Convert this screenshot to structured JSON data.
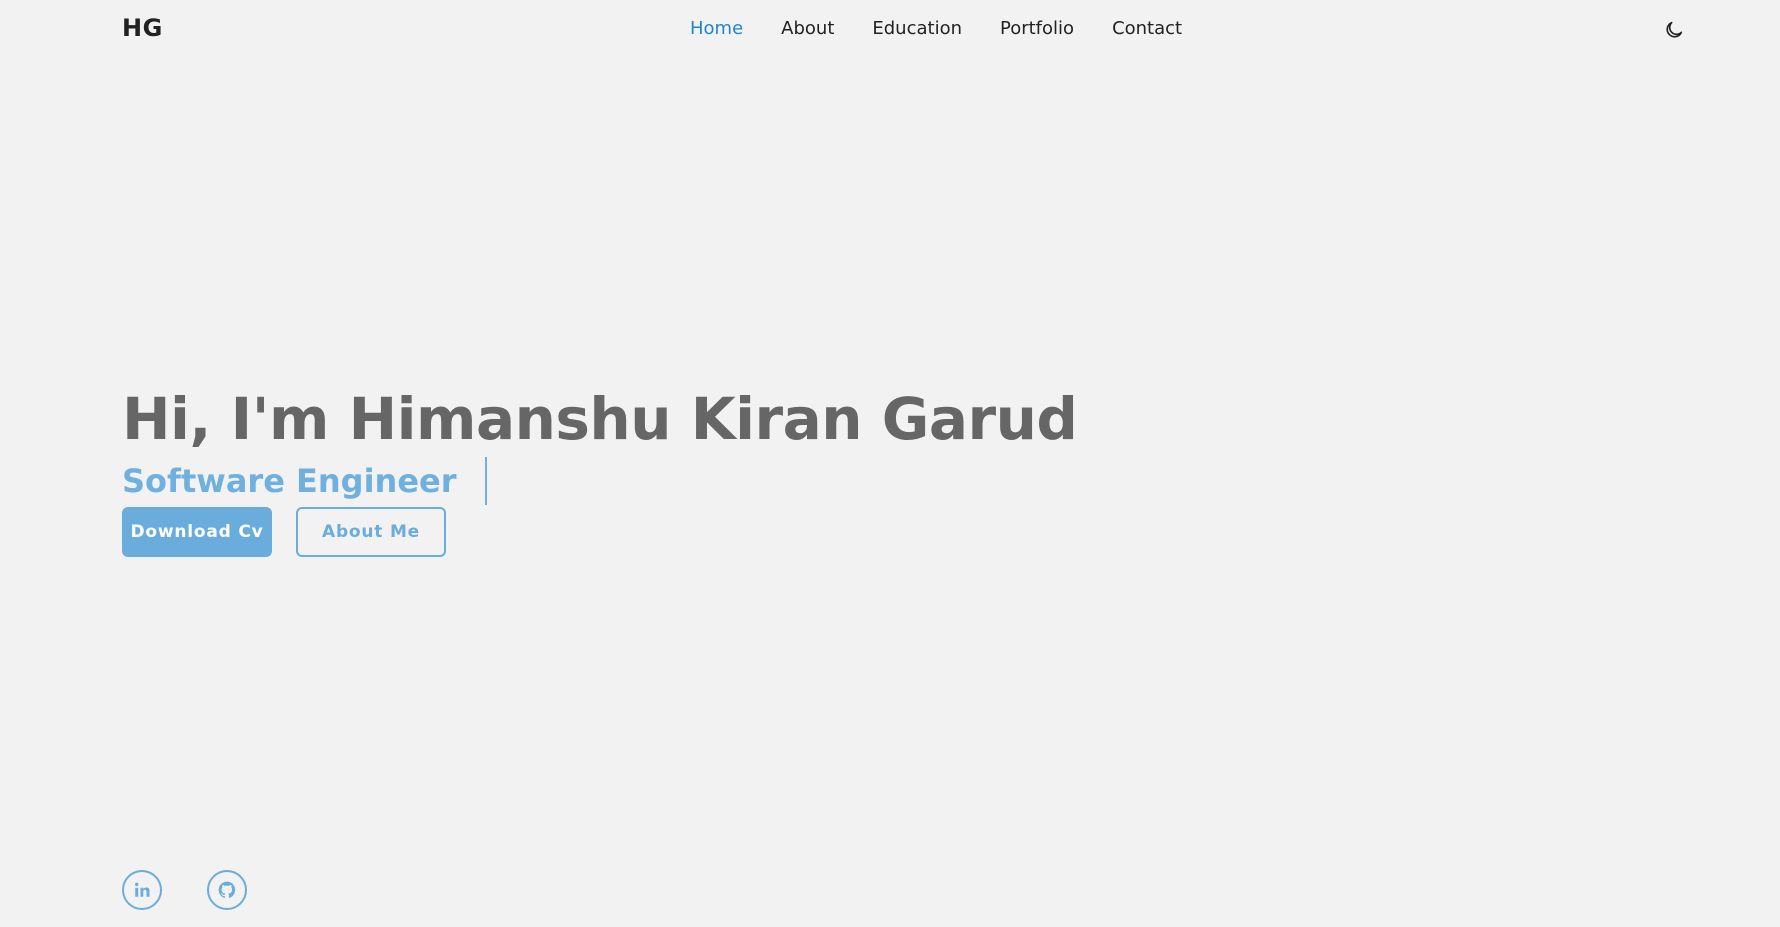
{
  "header": {
    "logo": "HG",
    "nav": [
      {
        "label": "Home",
        "active": true
      },
      {
        "label": "About"
      },
      {
        "label": "Education"
      },
      {
        "label": "Portfolio"
      },
      {
        "label": "Contact"
      }
    ],
    "theme_toggle_icon": "moon-icon"
  },
  "hero": {
    "title": "Hi, I'm Himanshu Kiran Garud",
    "subtitle": "Software Engineer",
    "primary_button": "Download Cv",
    "secondary_button": "About Me"
  },
  "socials": [
    {
      "icon": "linkedin-icon"
    },
    {
      "icon": "github-icon"
    }
  ],
  "colors": {
    "accent": "#6aaddd",
    "active_nav": "#1e87c9",
    "title": "#666666",
    "background": "#f2f2f2"
  }
}
